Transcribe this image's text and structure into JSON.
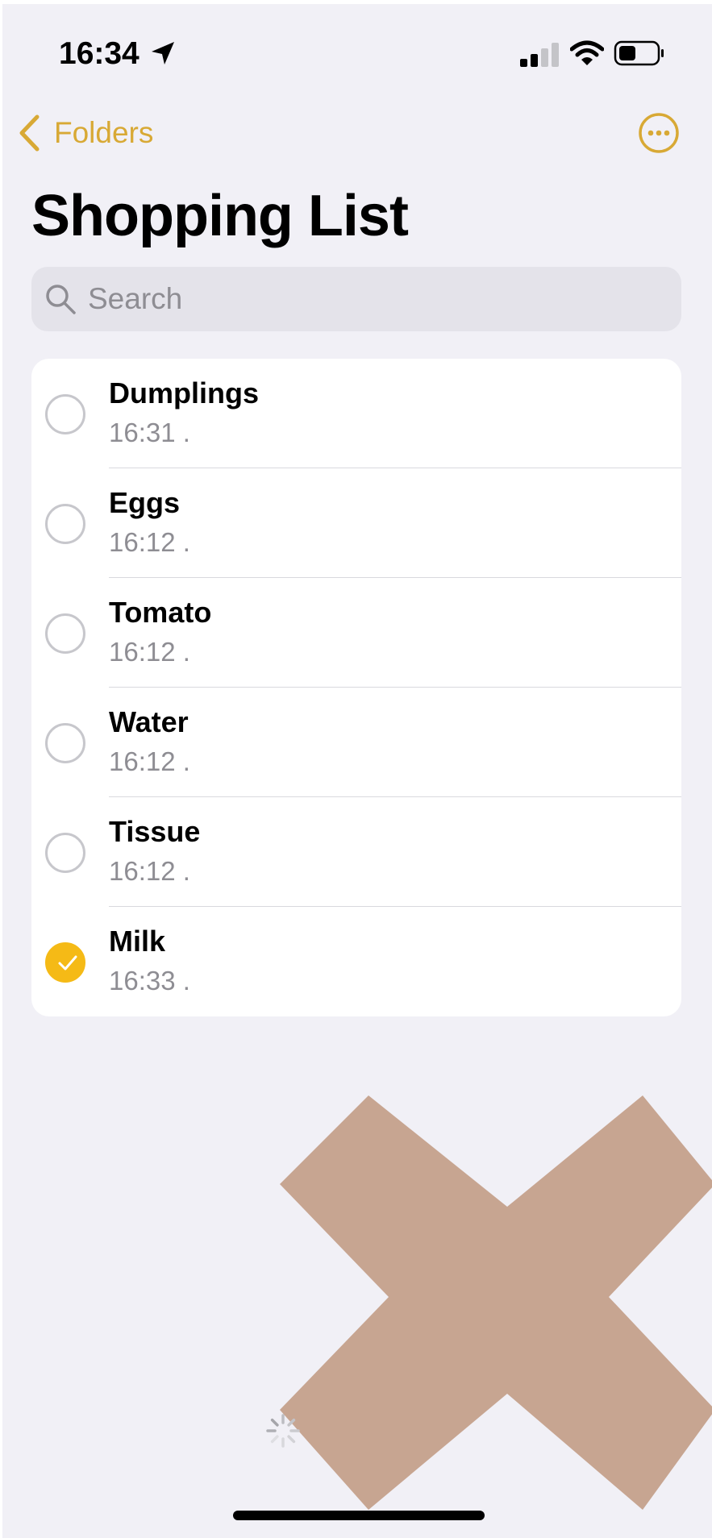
{
  "status_bar": {
    "time": "16:34",
    "location_icon": "location-arrow-icon",
    "signal_icon": "cellular-signal-icon",
    "wifi_icon": "wifi-icon",
    "battery_icon": "battery-icon"
  },
  "nav": {
    "back_label": "Folders",
    "back_icon": "chevron-left-icon",
    "more_icon": "ellipsis-circle-icon"
  },
  "title": "Shopping List",
  "search": {
    "placeholder": "Search",
    "value": ""
  },
  "items": [
    {
      "title": "Dumplings",
      "time": "16:31 .",
      "checked": false
    },
    {
      "title": "Eggs",
      "time": "16:12 .",
      "checked": false
    },
    {
      "title": "Tomato",
      "time": "16:12 .",
      "checked": false
    },
    {
      "title": "Water",
      "time": "16:12 .",
      "checked": false
    },
    {
      "title": "Tissue",
      "time": "16:12 .",
      "checked": false
    },
    {
      "title": "Milk",
      "time": "16:33 .",
      "checked": true
    }
  ],
  "colors": {
    "accent": "#d8a935",
    "check_fill": "#f5ba16",
    "background": "#f1f0f6",
    "cross_mark": "#c7a591"
  }
}
